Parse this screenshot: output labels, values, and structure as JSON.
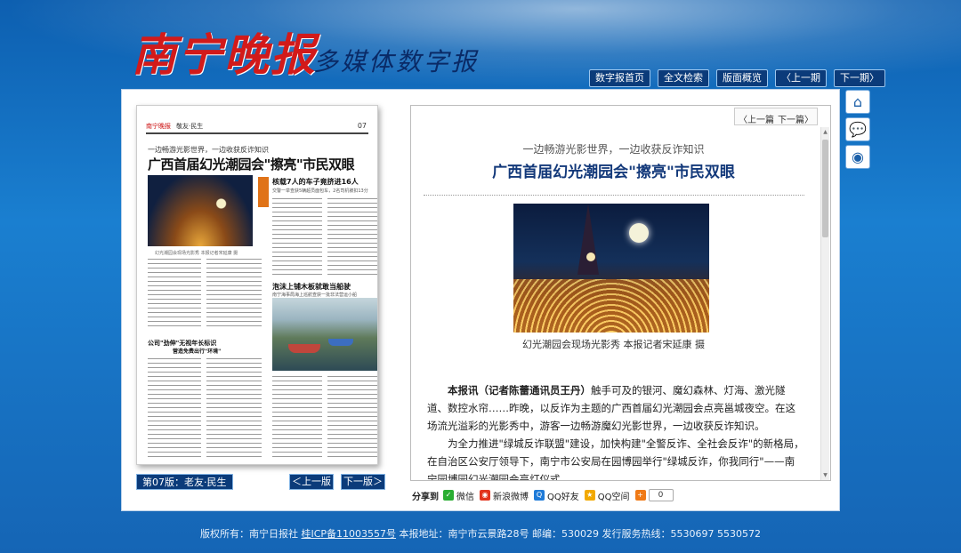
{
  "header": {
    "logo_text": "南宁晚报",
    "logo_subtitle": "多媒体数字报",
    "nav": [
      "数字报首页",
      "全文检索",
      "版面概览",
      "〈上一期",
      "下一期〉"
    ]
  },
  "sidebar_icons": [
    "home-icon",
    "comment-icon",
    "weibo-icon"
  ],
  "paper_preview": {
    "masthead": "南宁晚报",
    "section": "敬友·民生",
    "page_number": "07",
    "kicker": "一边畅游光影世界，一边收获反诈知识",
    "headline": "广西首届幻光潮园会\"擦亮\"市民双眼",
    "tag": "新闻",
    "sub1": "核载7人的车子竟挤进16人",
    "sub1_detail": "交警一举查获5辆超员面包车，2名司机被扣13分",
    "photo_caption": "幻光潮园会现场光影秀 本报记者宋延康 摄",
    "sub2": "泡沫上铺木板就敢当船驶",
    "sub2_detail": "南宁海事局海上巡航查获一批非法营运小船",
    "sub3": "公司\"劲伸\"无视年长标识",
    "sub3b": "营造免费出行\"环境\""
  },
  "left_footer": {
    "page_label": "第07版：老友·民生",
    "prev": "＜上一版",
    "next": "下一版＞"
  },
  "article": {
    "nav_prev": "〈上一篇",
    "nav_next": "下一篇〉",
    "kicker": "一边畅游光影世界，一边收获反诈知识",
    "title": "广西首届幻光潮园会\"擦亮\"市民双眼",
    "image_caption": "幻光潮园会现场光影秀 本报记者宋延康 摄",
    "lead": "本报讯（记者陈蕾通讯员王丹）",
    "p1": "触手可及的银河、魔幻森林、灯海、激光隧道、数控水帘……昨晚，以反诈为主题的广西首届幻光潮园会点亮邕城夜空。在这场流光溢彩的光影秀中，游客一边畅游魔幻光影世界，一边收获反诈知识。",
    "p2": "为全力推进\"绿城反诈联盟\"建设，加快构建\"全警反诈、全社会反诈\"的新格局，在自治区公安厅领导下，南宁市公安局在园博园举行\"绿城反诈，你我同行\"——南宁园博园幻光潮园会亮灯仪式"
  },
  "share": {
    "label": "分享到",
    "targets": [
      "微信",
      "新浪微博",
      "QQ好友",
      "QQ空间"
    ],
    "count": "0"
  },
  "footer": {
    "copyright": "版权所有：南宁日报社",
    "icp": "桂ICP备11003557号",
    "address": "本报地址：南宁市云景路28号",
    "postcode": "邮编：530029",
    "hotline": "发行服务热线：5530697 5530572"
  },
  "colors": {
    "page_bg": "#1565b5",
    "button_bg": "#0b3b7a",
    "title_blue": "#13397a",
    "logo_red": "#d21a1a"
  }
}
